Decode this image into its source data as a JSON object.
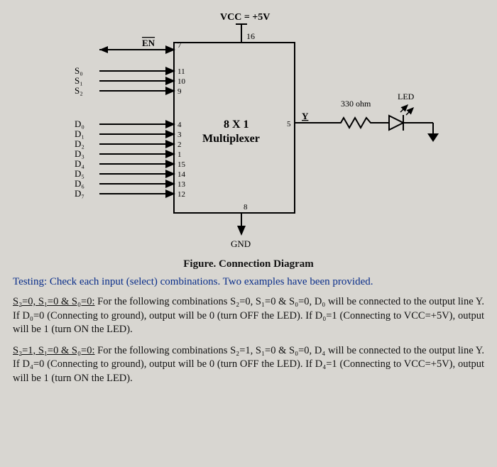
{
  "diagram": {
    "vcc_label": "VCC = +5V",
    "gnd_label": "GND",
    "enable_label": "EN",
    "pins": {
      "en": "7",
      "vcc": "16",
      "s0": "11",
      "s1": "10",
      "s2": "9",
      "d0": "4",
      "d1": "3",
      "d2": "2",
      "d3": "1",
      "d4": "15",
      "d5": "14",
      "d6": "13",
      "d7": "12",
      "gnd": "8",
      "y": "5"
    },
    "signals": {
      "s0": "S₀",
      "s1": "S₁",
      "s2": "S₂",
      "d0": "D₀",
      "d1": "D₁",
      "d2": "D₂",
      "d3": "D₃",
      "d4": "D₄",
      "d5": "D₅",
      "d6": "D₆",
      "d7": "D₇",
      "y": "Y"
    },
    "chip_line1": "8 X 1",
    "chip_line2": "Multiplexer",
    "resistor_label": "330 ohm",
    "led_label": "LED"
  },
  "caption": "Figure. Connection Diagram",
  "testing_line": "Testing: Check each input (select) combinations. Two examples have been provided.",
  "para1_lead": "S₂=0, S₁=0 & S₀=0:",
  "para1_body": " For the following combinations S₂=0, S₁=0 & S₀=0, D₀ will be connected to the output line Y. If D₀=0 (Connecting to ground), output will be 0 (turn OFF the LED). If D₀=1 (Connecting to VCC=+5V), output will be 1 (turn ON the LED).",
  "para2_lead": "S₂=1, S₁=0 & S₀=0:",
  "para2_body": " For the following combinations S₂=1, S₁=0 & S₀=0, D₄ will be connected to the output line Y. If D₄=0 (Connecting to ground), output will be 0 (turn OFF the LED). If D₄=1 (Connecting to VCC=+5V), output will be 1 (turn ON the LED)."
}
